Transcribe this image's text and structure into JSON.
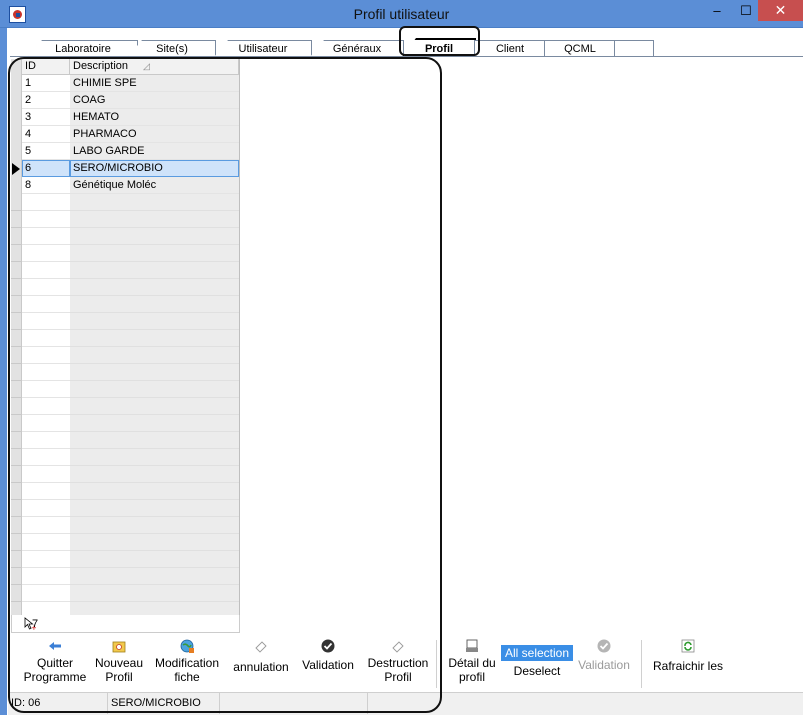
{
  "window": {
    "title": "Profil utilisateur",
    "minimize": "–",
    "maximize": "☐",
    "close": "✕"
  },
  "tabs": [
    {
      "label": "Laboratoire"
    },
    {
      "label": "Site(s)"
    },
    {
      "label": "Utilisateur"
    },
    {
      "label": "Généraux"
    },
    {
      "label": "Profil",
      "active": true
    },
    {
      "label": "Client"
    },
    {
      "label": "QCML"
    },
    {
      "label": ""
    }
  ],
  "grid": {
    "columns": [
      "ID",
      "Description"
    ],
    "sort_indicator": "◿",
    "rows": [
      {
        "id": "1",
        "description": "CHIMIE SPE"
      },
      {
        "id": "2",
        "description": "COAG"
      },
      {
        "id": "3",
        "description": "HEMATO"
      },
      {
        "id": "4",
        "description": "PHARMACO"
      },
      {
        "id": "5",
        "description": "LABO GARDE"
      },
      {
        "id": "6",
        "description": "SERO/MICROBIO",
        "selected": true
      },
      {
        "id": "8",
        "description": "Génétique Moléc"
      }
    ],
    "record_count": "7"
  },
  "toolbar": {
    "quitter": "Quitter Programme",
    "nouveau": "Nouveau Profil",
    "modification": "Modification fiche",
    "annulation": "annulation",
    "validation": "Validation",
    "destruction": "Destruction Profil",
    "detail": "Détail du profil",
    "all_selection": "All selection",
    "deselect": "Deselect",
    "validation2": "Validation",
    "rafraichir": "Rafraichir les"
  },
  "status": {
    "id": "ID: 06",
    "description": "SERO/MICROBIO"
  },
  "colors": {
    "titlebar": "#5b8ed6",
    "close": "#c74f4f",
    "selection": "#cfe3fa",
    "highlight": "#3a8ee6"
  }
}
